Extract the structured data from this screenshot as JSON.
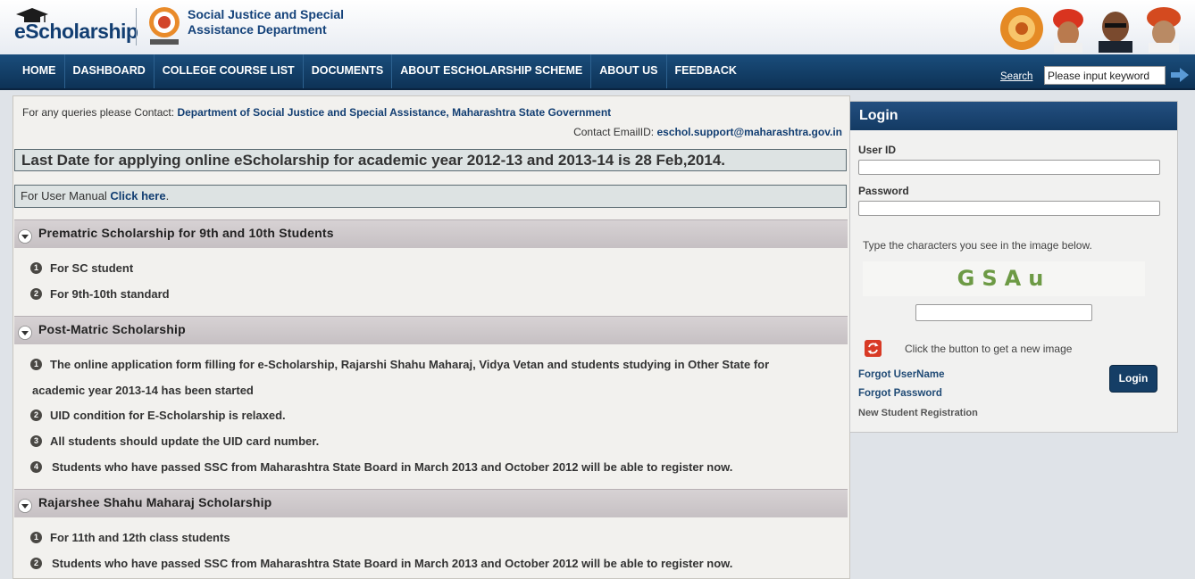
{
  "header": {
    "logo_text": "eScholarship",
    "department_line1": "Social Justice and Special",
    "department_line2": "Assistance Department"
  },
  "nav": {
    "items": [
      "HOME",
      "DASHBOARD",
      "COLLEGE COURSE LIST",
      "DOCUMENTS",
      "ABOUT ESCHOLARSHIP SCHEME",
      "ABOUT US",
      "FEEDBACK"
    ],
    "search_label": "Search",
    "search_value": "Please input keyword"
  },
  "main": {
    "contact_prefix": "For any queries please Contact: ",
    "contact_org": "Department of Social Justice and Special Assistance, Maharashtra State Government",
    "email_prefix": "Contact EmailID: ",
    "email": "eschol.support@maharashtra.gov.in",
    "last_date": "Last Date for applying online eScholarship for academic year 2012-13 and 2013-14 is 28 Feb,2014.",
    "manual_prefix": "For User Manual ",
    "manual_link": "Click here",
    "manual_suffix": ".",
    "sections": [
      {
        "title": "Prematric Scholarship for 9th and 10th Students",
        "items": [
          "For SC student",
          "For 9th-10th standard"
        ]
      },
      {
        "title": "Post-Matric Scholarship",
        "items": [
          "The online application form filling for e-Scholarship, Rajarshi Shahu Maharaj, Vidya Vetan and students studying in Other State for",
          "academic year 2013-14 has been started",
          "UID condition for E-Scholarship is relaxed.",
          "All students should update the UID card number.",
          "Students who have passed SSC from Maharashtra State Board in March 2013 and October 2012 will be able to register now."
        ]
      },
      {
        "title": "Rajarshee Shahu Maharaj Scholarship",
        "items": [
          "For 11th and 12th class students",
          "Students who have passed SSC from Maharashtra State Board in March 2013 and October 2012 will be able to register now."
        ]
      }
    ],
    "numbers": [
      "1",
      "2",
      "3",
      "4"
    ]
  },
  "login": {
    "title": "Login",
    "user_id_label": "User ID",
    "password_label": "Password",
    "captcha_prompt": "Type the characters you see in the image below.",
    "captcha_text": "GSAu",
    "refresh_text": "Click the button to get a new image",
    "forgot_username": "Forgot UserName",
    "forgot_password": "Forgot Password",
    "new_registration": "New Student Registration",
    "login_button": "Login"
  },
  "colors": {
    "nav_bg": "#0d3256",
    "accent_blue": "#123e72",
    "refresh_red": "#d83a25",
    "captcha_green": "#6d9a45"
  }
}
